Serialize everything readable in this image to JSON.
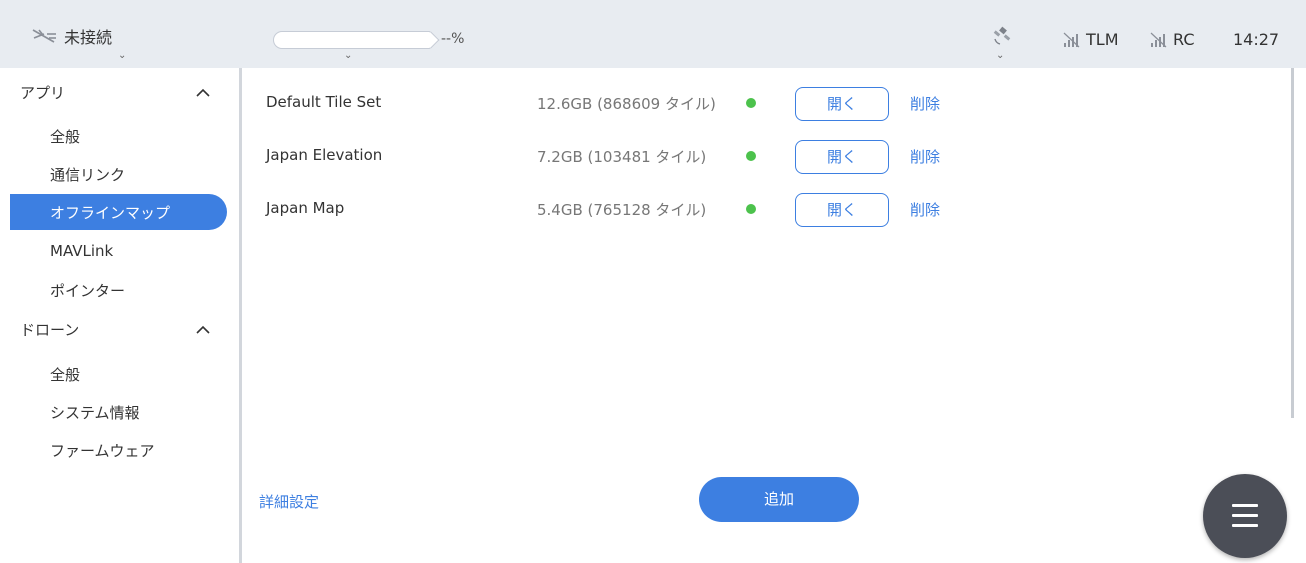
{
  "topbar": {
    "connection_label": "未接続",
    "progress_label": "--%",
    "progress_value": 0,
    "tlm_label": "TLM",
    "rc_label": "RC",
    "time": "14:27"
  },
  "sidebar": {
    "sections": [
      {
        "label": "アプリ",
        "items": [
          "全般",
          "通信リンク",
          "オフラインマップ",
          "MAVLink",
          "ポインター"
        ]
      },
      {
        "label": "ドローン",
        "items": [
          "全般",
          "システム情報",
          "ファームウェア"
        ]
      }
    ],
    "active_item": "オフラインマップ"
  },
  "maps": [
    {
      "name": "Default Tile Set",
      "size": "12.6GB (868609 タイル)",
      "open_label": "開く",
      "delete_label": "削除"
    },
    {
      "name": "Japan Elevation",
      "size": "7.2GB (103481 タイル)",
      "open_label": "開く",
      "delete_label": "削除"
    },
    {
      "name": "Japan Map",
      "size": "5.4GB (765128 タイル)",
      "open_label": "開く",
      "delete_label": "削除"
    }
  ],
  "footer": {
    "detail_label": "詳細設定",
    "add_label": "追加"
  },
  "icons": {
    "connection": "no-link-icon",
    "satellite": "satellite-icon",
    "signal": "signal-off-icon",
    "menu": "hamburger-menu-icon"
  },
  "colors": {
    "accent": "#3d7fe1",
    "status_ok": "#4cc24c",
    "topbar_bg": "#e8ecf1",
    "fab_bg": "#4b4e57"
  }
}
